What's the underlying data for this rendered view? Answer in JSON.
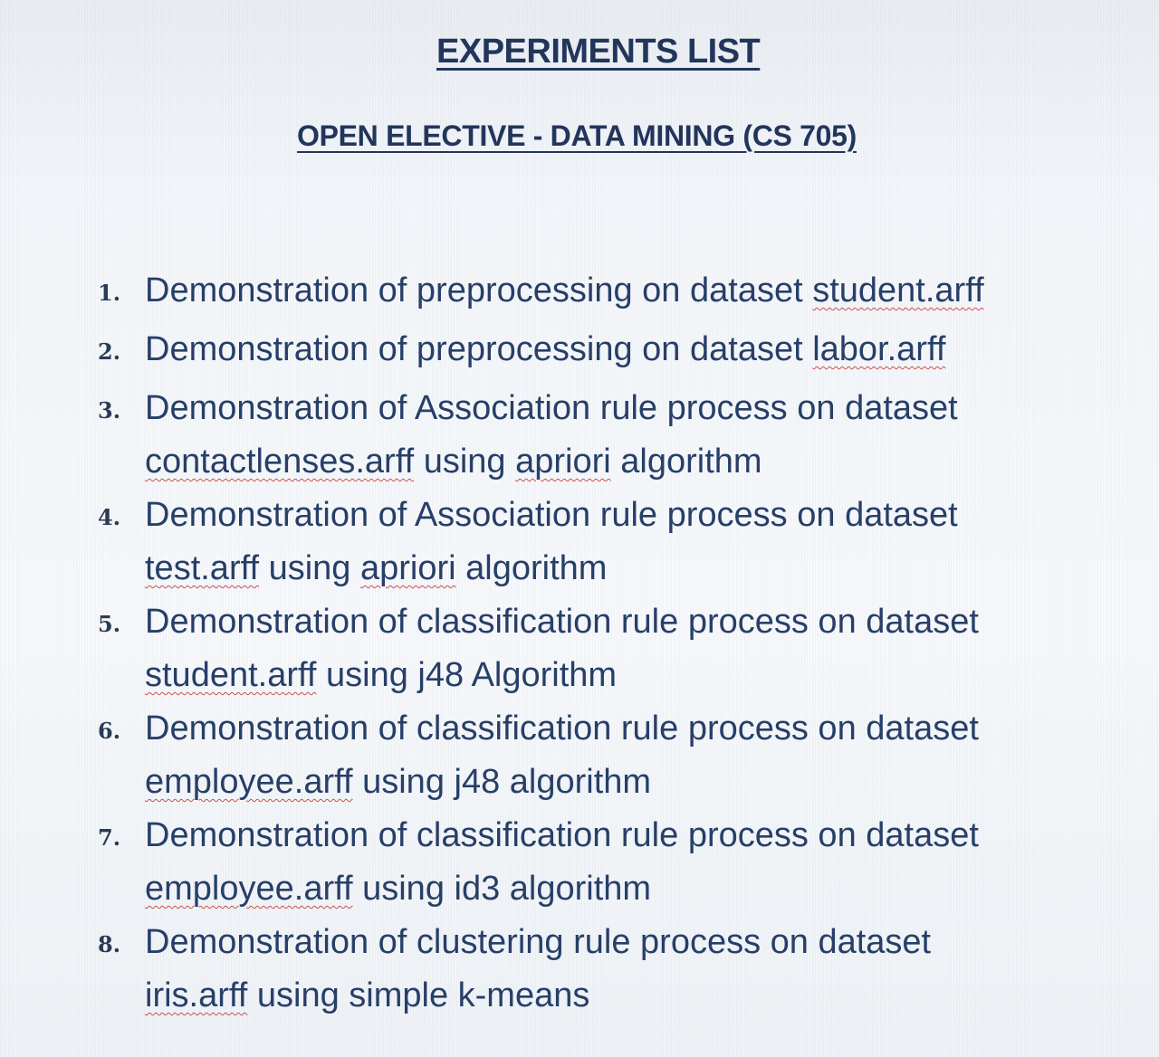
{
  "title": "EXPERIMENTS LIST",
  "subtitle": "OPEN ELECTIVE -  DATA MINING  (CS 705)",
  "experiments": [
    {
      "number": "1.",
      "line1": "Demonstration of preprocessing on dataset ",
      "file": "student.arff",
      "line2": "",
      "line2_rest": ""
    },
    {
      "number": "2.",
      "line1": "Demonstration of preprocessing on dataset ",
      "file": "labor.arff",
      "line2": "",
      "line2_rest": ""
    },
    {
      "number": "3.",
      "line1": "Demonstration of Association rule process on dataset",
      "file": "contactlenses.arff",
      "line2_pre": " using ",
      "algo_sq": "apriori",
      "line2_rest": " algorithm"
    },
    {
      "number": "4.",
      "line1": "Demonstration of Association rule process on dataset",
      "file": "test.arff",
      "line2_pre": " using ",
      "algo_sq": "apriori",
      "line2_rest": " algorithm"
    },
    {
      "number": "5.",
      "line1": "Demonstration of classification rule process on dataset",
      "file": "student.arff",
      "line2_pre": " using j48 Algorithm",
      "algo_sq": "",
      "line2_rest": ""
    },
    {
      "number": "6.",
      "line1": "Demonstration of classification rule process on dataset",
      "file": "employee.arff",
      "line2_pre": " using j48 algorithm",
      "algo_sq": "",
      "line2_rest": ""
    },
    {
      "number": "7.",
      "line1": "Demonstration of classification rule process on dataset",
      "file": "employee.arff",
      "line2_pre": " using id3 algorithm",
      "algo_sq": "",
      "line2_rest": ""
    },
    {
      "number": "8.",
      "line1": "Demonstration of clustering rule process on dataset",
      "file": "iris.arff",
      "line2_pre": " using simple k-means",
      "algo_sq": "",
      "line2_rest": ""
    }
  ]
}
